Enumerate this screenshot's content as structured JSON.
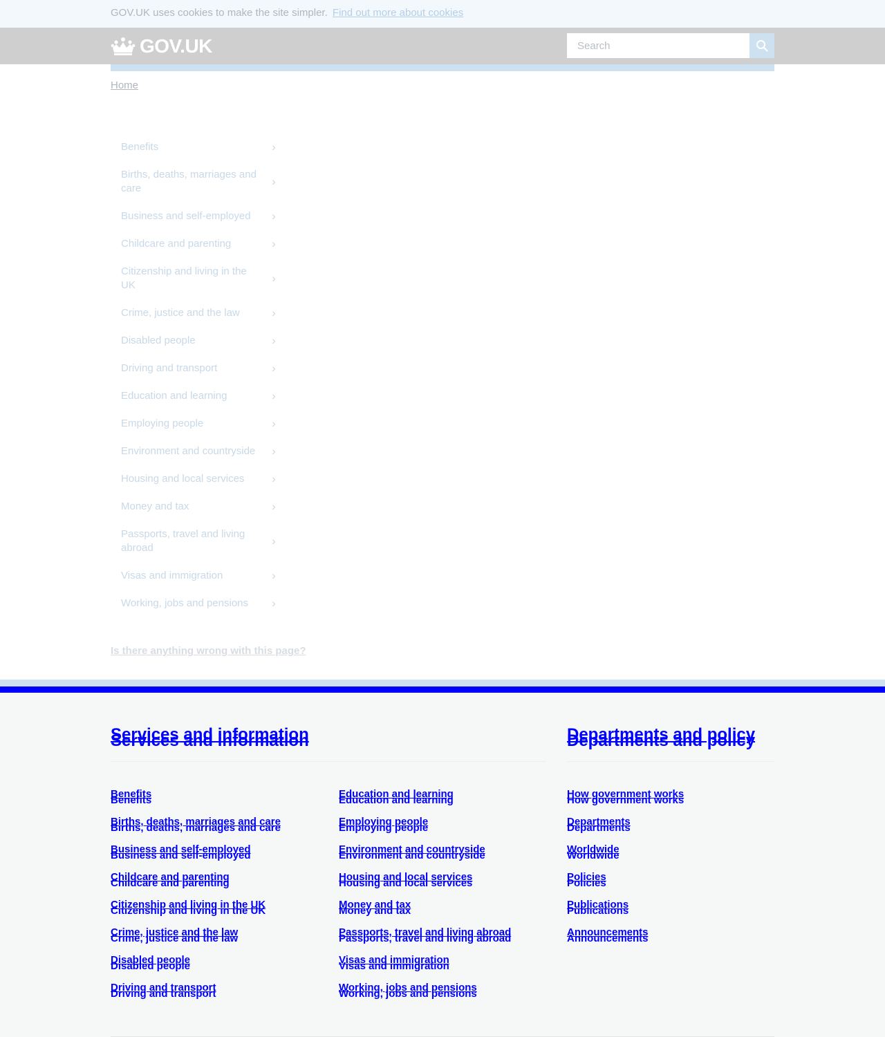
{
  "cookie_banner": {
    "text": "GOV.UK uses cookies to make the site simpler.",
    "link": "Find out more about cookies"
  },
  "header": {
    "logo_text": "GOV.UK",
    "search_placeholder": "Search"
  },
  "breadcrumb": {
    "home": "Home"
  },
  "topics": [
    "Benefits",
    "Births, deaths, marriages and care",
    "Business and self-employed",
    "Childcare and parenting",
    "Citizenship and living in the UK",
    "Crime, justice and the law",
    "Disabled people",
    "Driving and transport",
    "Education and learning",
    "Employing people",
    "Environment and countryside",
    "Housing and local services",
    "Money and tax",
    "Passports, travel and living abroad",
    "Visas and immigration",
    "Working, jobs and pensions"
  ],
  "chevron": "›",
  "report_link": "Is there anything wrong with this page?",
  "footer": {
    "services_heading": "Services and information",
    "departments_heading": "Departments and policy",
    "services_col1": [
      "Benefits",
      "Births, deaths, marriages and care",
      "Business and self-employed",
      "Childcare and parenting",
      "Citizenship and living in the UK",
      "Crime, justice and the law",
      "Disabled people",
      "Driving and transport"
    ],
    "services_col2": [
      "Education and learning",
      "Employing people",
      "Environment and countryside",
      "Housing and local services",
      "Money and tax",
      "Passports, travel and living abroad",
      "Visas and immigration",
      "Working, jobs and pensions"
    ],
    "departments": [
      "How government works",
      "Departments",
      "Worldwide",
      "Policies",
      "Publications",
      "Announcements"
    ]
  },
  "colors": {
    "link_blue": "#0000ff",
    "header_grey": "#cfcfcf",
    "rule_blue": "#cde1f0",
    "footer_bg": "#f6f8f8"
  },
  "icons": {
    "logo": "crown-icon",
    "search": "search-icon",
    "chevron": "chevron-right-icon"
  }
}
